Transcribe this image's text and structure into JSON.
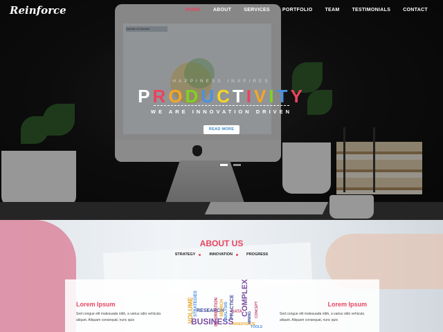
{
  "brand": {
    "logo": "Reinforce"
  },
  "nav": {
    "items": [
      "HOME",
      "ABOUT",
      "SERVICES",
      "PORTFOLIO",
      "TEAM",
      "TESTIMONIALS",
      "CONTACT"
    ],
    "active": "HOME"
  },
  "hero": {
    "tagline": "HAPPINESS INSPIRES",
    "headline_letters": [
      "P",
      "R",
      "O",
      "D",
      "U",
      "C",
      "T",
      "I",
      "V",
      "I",
      "T",
      "Y"
    ],
    "headline_colors": [
      "#ffffff",
      "#e9445f",
      "#f6a623",
      "#7ed321",
      "#4a90e2",
      "#f5d523",
      "#ffffff",
      "#e9445f",
      "#f6a623",
      "#7ed321",
      "#4a90e2",
      "#e9445f"
    ],
    "subheading": "WE ARE INNOVATION DRIVEN",
    "cta": "READ MORE",
    "slide_count": 2,
    "active_slide": 0,
    "monitor_title": "Domain vs Domain"
  },
  "about": {
    "title": "ABOUT US",
    "pillars": [
      "STRATEGY",
      "INNOVATION",
      "PROGRESS"
    ],
    "left": {
      "heading": "Lorem Ipsum",
      "text": "Sed congue elit malesuada nibh, a varius odio vehicula aliquet. Aliquam consequat, nunc quis"
    },
    "right": {
      "heading": "Lorem Ipsum",
      "text": "Sed congue elit malesuada nibh, a varius odio vehicula aliquet. Aliquam consequat, nunc quis"
    },
    "word_cloud": [
      "VOLUME",
      "STRATEGIES",
      "RESEARCH",
      "INFORMATION",
      "BUSINESS",
      "SEARCH",
      "ANALYSIS",
      "PRACTICE",
      "DATA",
      "COMPLEX",
      "INVESTIGATE",
      "TOOLS",
      "MINING",
      "CONCEPT"
    ]
  },
  "colors": {
    "accent": "#e9445f",
    "nav_text": "#ffffff",
    "cta_text": "#3a86c8"
  }
}
